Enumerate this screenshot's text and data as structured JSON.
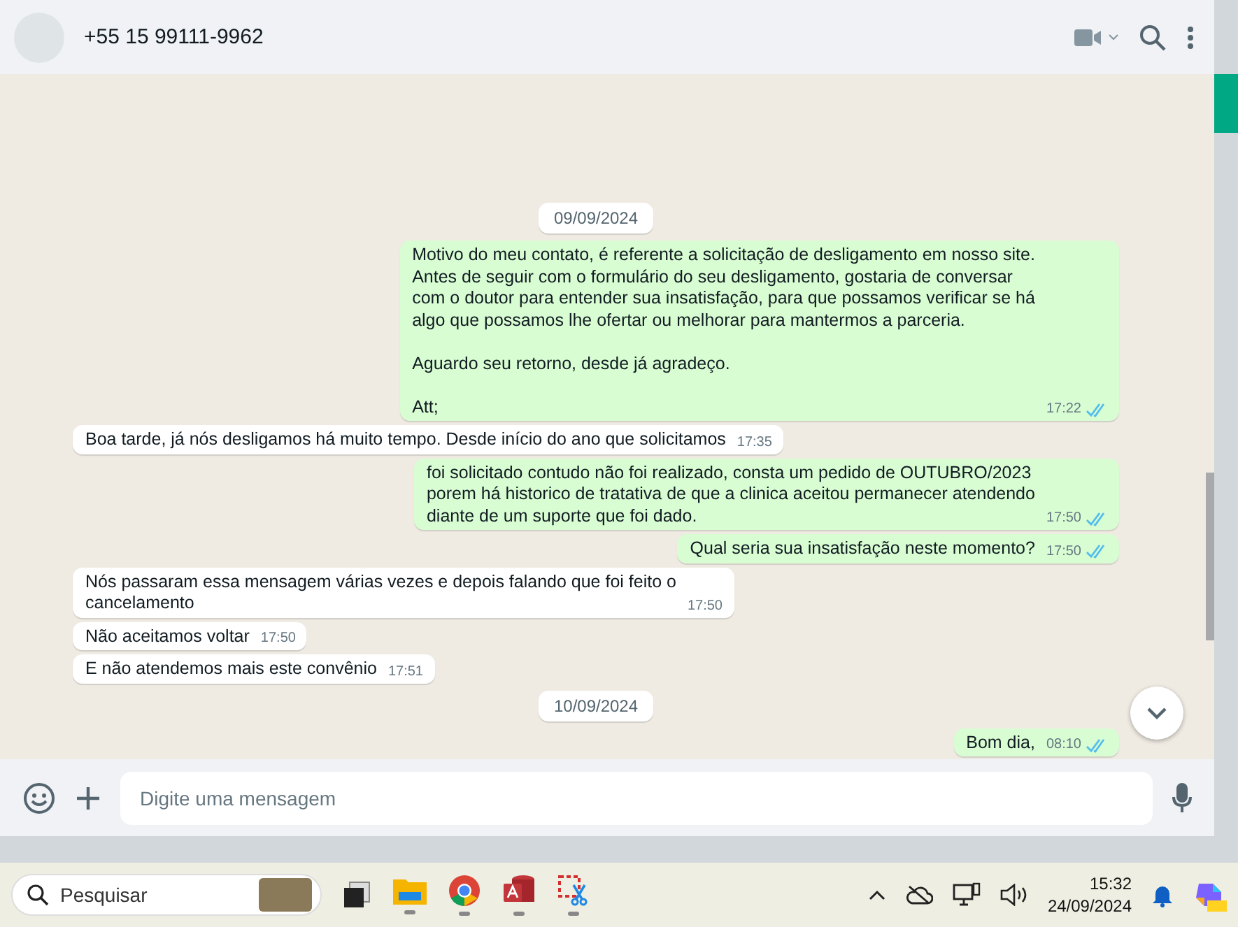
{
  "header": {
    "contact": "+55 15 99111-9962"
  },
  "messages": [
    {
      "kind": "date",
      "text": "09/09/2024"
    },
    {
      "kind": "out",
      "text": "Motivo do meu contato, é referente a solicitação de desligamento em nosso site.\nAntes de seguir com o formulário do seu desligamento, gostaria de conversar\ncom o doutor para entender sua insatisfação, para que possamos verificar se há\nalgo que possamos lhe ofertar ou melhorar para mantermos a parceria.\n\nAguardo seu retorno, desde já agradeço.\n\nAtt;",
      "time": "17:22",
      "read": true
    },
    {
      "kind": "in",
      "text": "Boa tarde, já nós desligamos há muito tempo. Desde início do ano que solicitamos",
      "time": "17:35"
    },
    {
      "kind": "out",
      "text": "foi solicitado contudo não foi realizado, consta um pedido de OUTUBRO/2023\nporem há historico de tratativa de que a clinica aceitou permanecer atendendo\ndiante de um suporte que foi dado.",
      "time": "17:50",
      "read": true
    },
    {
      "kind": "out",
      "text": "Qual seria sua insatisfação neste momento?",
      "time": "17:50",
      "read": true
    },
    {
      "kind": "in",
      "text": "Nós passaram essa mensagem várias vezes e depois falando que foi feito o\ncancelamento",
      "time": "17:50"
    },
    {
      "kind": "in",
      "text": "Não aceitamos voltar",
      "time": "17:50"
    },
    {
      "kind": "in",
      "text": "E não atendemos mais este convênio",
      "time": "17:51"
    },
    {
      "kind": "date",
      "text": "10/09/2024"
    },
    {
      "kind": "out",
      "text": "Bom dia,",
      "time": "08:10",
      "read": true
    }
  ],
  "composer": {
    "placeholder": "Digite uma mensagem"
  },
  "taskbar": {
    "search_placeholder": "Pesquisar",
    "time": "15:32",
    "date": "24/09/2024"
  }
}
